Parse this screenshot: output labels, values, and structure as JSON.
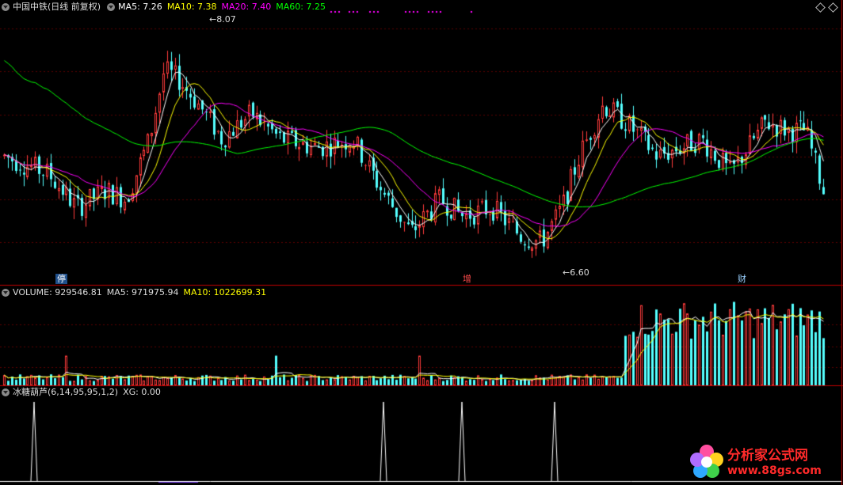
{
  "colors": {
    "up": "#ff3b3b",
    "down": "#54ffff",
    "ma5": "#ffffff",
    "ma10": "#ffff00",
    "ma20": "#ff00ff",
    "ma60": "#00ff00",
    "grid": "#5a0000",
    "divider": "#c00000"
  },
  "header": {
    "title": "中国中铁(日线 前复权)",
    "ma5": "MA5: 7.26",
    "ma10": "MA10: 7.38",
    "ma20": "MA20: 7.40",
    "ma60": "MA60: 7.25"
  },
  "price_panel": {
    "high_label": "8.07",
    "low_label": "6.60",
    "events": [
      "停",
      "增",
      "财"
    ]
  },
  "volume_panel": {
    "volume": "VOLUME: 929546.81",
    "ma5": "MA5: 971975.94",
    "ma10": "MA10: 1022699.31"
  },
  "indicator_panel": {
    "name": "冰糖葫芦(6,14,95,95,1,2)",
    "xg": "XG: 0.00"
  },
  "watermark": {
    "name": "分析家公式网",
    "url": "www.88gs.com"
  },
  "chart_data": {
    "type": "candlestick",
    "price_high": 8.07,
    "price_low": 6.6,
    "signal_bars": [
      10,
      119,
      143,
      172
    ]
  }
}
